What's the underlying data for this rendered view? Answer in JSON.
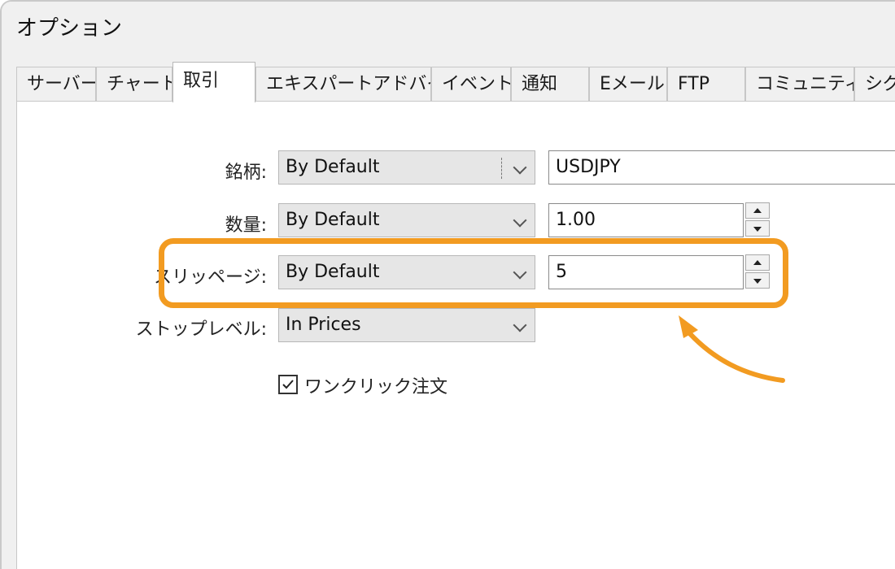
{
  "window": {
    "title": "オプション"
  },
  "tabs": [
    {
      "label": "サーバー",
      "active": false
    },
    {
      "label": "チャート",
      "active": false
    },
    {
      "label": "取引",
      "active": true
    },
    {
      "label": "エキスパートアドバイザ",
      "active": false
    },
    {
      "label": "イベント",
      "active": false
    },
    {
      "label": "通知",
      "active": false
    },
    {
      "label": "Eメール",
      "active": false
    },
    {
      "label": "FTP",
      "active": false
    },
    {
      "label": "コミュニティー",
      "active": false
    },
    {
      "label": "シグ",
      "active": false
    }
  ],
  "form": {
    "symbol": {
      "label": "銘柄:",
      "mode": "By Default",
      "value": "USDJPY"
    },
    "volume": {
      "label": "数量:",
      "mode": "By Default",
      "value": "1.00"
    },
    "slippage": {
      "label": "スリッページ:",
      "mode": "By Default",
      "value": "5"
    },
    "stoplevel": {
      "label": "ストップレベル:",
      "mode": "In Prices"
    },
    "one_click": {
      "label": "ワンクリック注文",
      "checked": true
    }
  },
  "annotation": {
    "highlight_color": "#f29b21",
    "arrow_color": "#f29b21"
  },
  "icons": {
    "dropdown": "chevron-down-icon",
    "spinner_up": "triangle-up-icon",
    "spinner_down": "triangle-down-icon",
    "check": "checkmark-icon"
  }
}
